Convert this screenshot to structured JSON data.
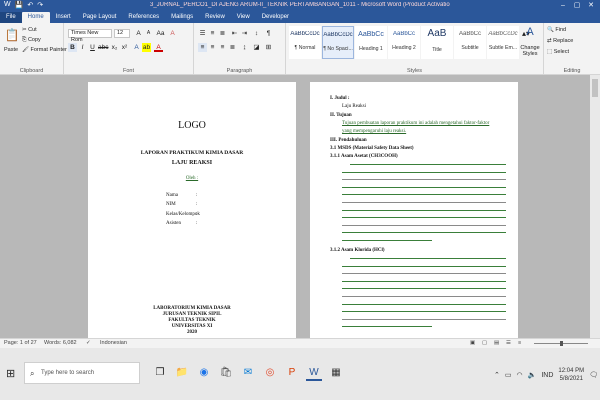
{
  "window": {
    "title": "3_JURNAL_PERCO1_DI AJENG ARUM-II_TEKNIK PERTAMBANGAN_1011 - Microsoft Word (Product Activation Failed)",
    "minimize": "–",
    "maximize": "▢",
    "close": "✕"
  },
  "tabs": [
    "File",
    "Home",
    "Insert",
    "Page Layout",
    "References",
    "Mailings",
    "Review",
    "View",
    "Developer"
  ],
  "ribbon": {
    "clipboard": {
      "label": "Clipboard",
      "paste": "Paste",
      "cut": "Cut",
      "copy": "Copy",
      "format_painter": "Format Painter"
    },
    "font": {
      "label": "Font",
      "family": "Times New Rom",
      "size": "12"
    },
    "paragraph": {
      "label": "Paragraph"
    },
    "styles": {
      "label": "Styles",
      "items": [
        {
          "preview": "AaBbCcDc",
          "name": "¶ Normal"
        },
        {
          "preview": "AaBbCcDc",
          "name": "¶ No Spaci..."
        },
        {
          "preview": "AaBbCc",
          "name": "Heading 1"
        },
        {
          "preview": "AaBbCc",
          "name": "Heading 2"
        },
        {
          "preview": "AaB",
          "name": "Title"
        },
        {
          "preview": "AaBbCc",
          "name": "Subtitle"
        },
        {
          "preview": "AaBbCcDc",
          "name": "Subtle Em..."
        }
      ],
      "change_styles": "Change Styles"
    },
    "editing": {
      "label": "Editing",
      "find": "Find",
      "replace": "Replace",
      "select": "Select"
    }
  },
  "page1": {
    "logo": "LOGO",
    "heading1": "LAPORAN PRAKTIKUM KIMIA DASAR",
    "heading2": "LAJU REAKSI",
    "oleh": "Oleh :",
    "fields": [
      "Nama",
      "NIM",
      "Kelas/Kelompok",
      "Asisten"
    ],
    "colon": ":",
    "footer": [
      "LABORATORIUM KIMIA DASAR",
      "JURUSAN TEKNIK SIPIL",
      "FAKULTAS TEKNIK",
      "UNIVERSITAS XI",
      "2020"
    ]
  },
  "page2": {
    "h1": "I.     Judul :",
    "h1_text": "Laju Reaksi",
    "h2": "II.    Tujuan",
    "h2_text": "Tujuan pembuatan laporan praktikum ini adalah mengetahui faktor-faktor",
    "h2_text2": "yang mempengaruhi laju reaksi.",
    "h3": "III.   Pendahuluan",
    "h31": "3.1    MSDS (Material Safety Data Sheet)",
    "h311": "3.1.1  Asam Asetat (CH3COOH)",
    "h312": "3.1.2  Asam Klorida (HCl)"
  },
  "status": {
    "page": "Page: 1 of 27",
    "words": "Words: 6,082",
    "language": "Indonesian"
  },
  "taskbar": {
    "search_placeholder": "Type here to search",
    "tray_lang": "IND",
    "time": "12:04 PM",
    "date": "5/8/2021"
  }
}
